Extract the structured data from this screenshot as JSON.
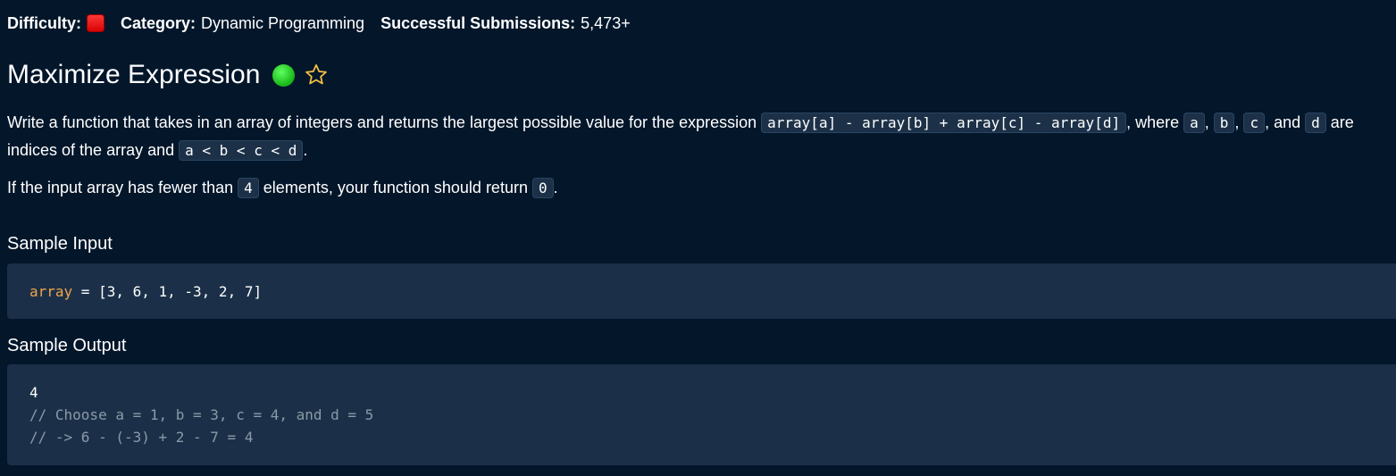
{
  "meta": {
    "difficulty_label": "Difficulty:",
    "category_label": "Category:",
    "category_value": "Dynamic Programming",
    "submissions_label": "Successful Submissions:",
    "submissions_value": "5,473+",
    "difficulty_color": "#e60000"
  },
  "problem": {
    "title": "Maximize Expression",
    "status_color": "#22c022",
    "favorite_icon": "star-outline-icon"
  },
  "description": {
    "p1_text_1": "Write a function that takes in an array of integers and returns the largest possible value for the expression ",
    "p1_code_expression": "array[a] - array[b] + array[c] - array[d]",
    "p1_text_2": ", where ",
    "p1_code_a": "a",
    "p1_sep_1": ", ",
    "p1_code_b": "b",
    "p1_sep_2": ", ",
    "p1_code_c": "c",
    "p1_text_3": ", and ",
    "p1_code_d": "d",
    "p1_text_4": " are indices of the array and ",
    "p1_code_order": "a < b < c < d",
    "p1_text_5": ".",
    "p2_text_1": "If the input array has fewer than ",
    "p2_code_4": "4",
    "p2_text_2": " elements, your function should return ",
    "p2_code_0": "0",
    "p2_text_3": "."
  },
  "sample_input": {
    "heading": "Sample Input",
    "var_name": "array",
    "assignment": " = [3, 6, 1, -3, 2, 7]"
  },
  "sample_output": {
    "heading": "Sample Output",
    "lines": [
      "4",
      "// Choose a = 1, b = 3, c = 4, and d = 5",
      "// -> 6 - (-3) + 2 - 7 = 4"
    ]
  }
}
